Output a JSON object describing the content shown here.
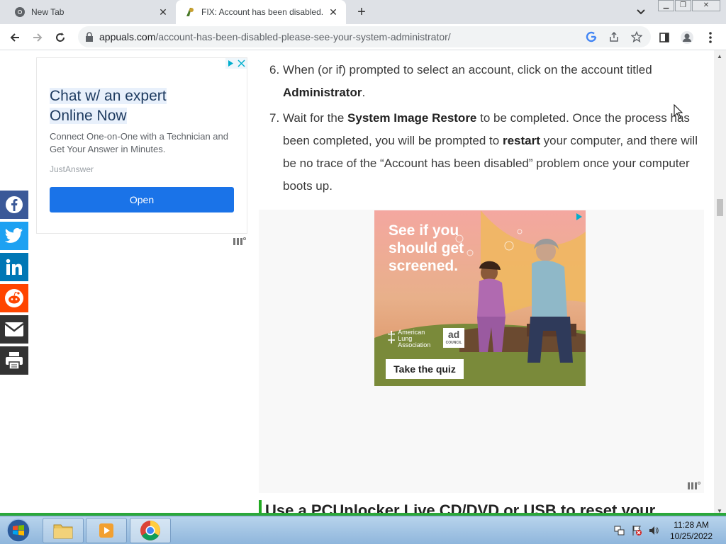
{
  "browser": {
    "tabs": [
      {
        "label": "New Tab",
        "icon": "chrome-icon",
        "active": false
      },
      {
        "label": "FIX: Account has been disabled. Please see your system administrator",
        "icon": "appuals-icon",
        "active": true
      }
    ],
    "new_tab_symbol": "+",
    "tab_close_symbol": "✕",
    "url_host": "appuals.com",
    "url_path": "/account-has-been-disabled-please-see-your-system-administrator/"
  },
  "ad_left": {
    "headline_line1": "Chat w/ an expert",
    "headline_line2": "Online Now",
    "description": "Connect One-on-One with a Technician and Get Your Answer in Minutes.",
    "brand": "JustAnswer",
    "button": "Open"
  },
  "share_icons": [
    {
      "name": "facebook-icon",
      "color": "#3b5998"
    },
    {
      "name": "twitter-icon",
      "color": "#1da1f2"
    },
    {
      "name": "linkedin-icon",
      "color": "#0077b5"
    },
    {
      "name": "reddit-icon",
      "color": "#ff4500"
    },
    {
      "name": "email-icon",
      "color": "#333333"
    },
    {
      "name": "print-icon",
      "color": "#333333"
    }
  ],
  "article": {
    "step6": {
      "num": "6.",
      "pre": "When (or if) prompted to select an account, click on the account titled",
      "bold": "Administrator",
      "post": "."
    },
    "step7": {
      "num": "7.",
      "pre": "Wait for the",
      "bold1": "System Image Restore",
      "mid": "to be completed. Once the process has been completed, you will be prompted to",
      "bold2": "restart",
      "post": "your computer, and there will be no trace of the “Account has been disabled” problem once your computer boots up."
    },
    "next_heading": "Use a PCUnlocker Live CD/DVD or USB to reset your"
  },
  "ad_center": {
    "headline_line1": "See if you",
    "headline_line2": "should get",
    "headline_line3": "screened.",
    "org_line1": "American",
    "org_line2": "Lung",
    "org_line3": "Association",
    "adcouncil_top": "ad",
    "adcouncil_bottom": "COUNCIL",
    "cta": "Take the quiz"
  },
  "taskbar": {
    "time": "11:28 AM",
    "date": "10/25/2022"
  },
  "colors": {
    "accent_blue": "#1a73e8",
    "heading_green": "#22aa22"
  }
}
